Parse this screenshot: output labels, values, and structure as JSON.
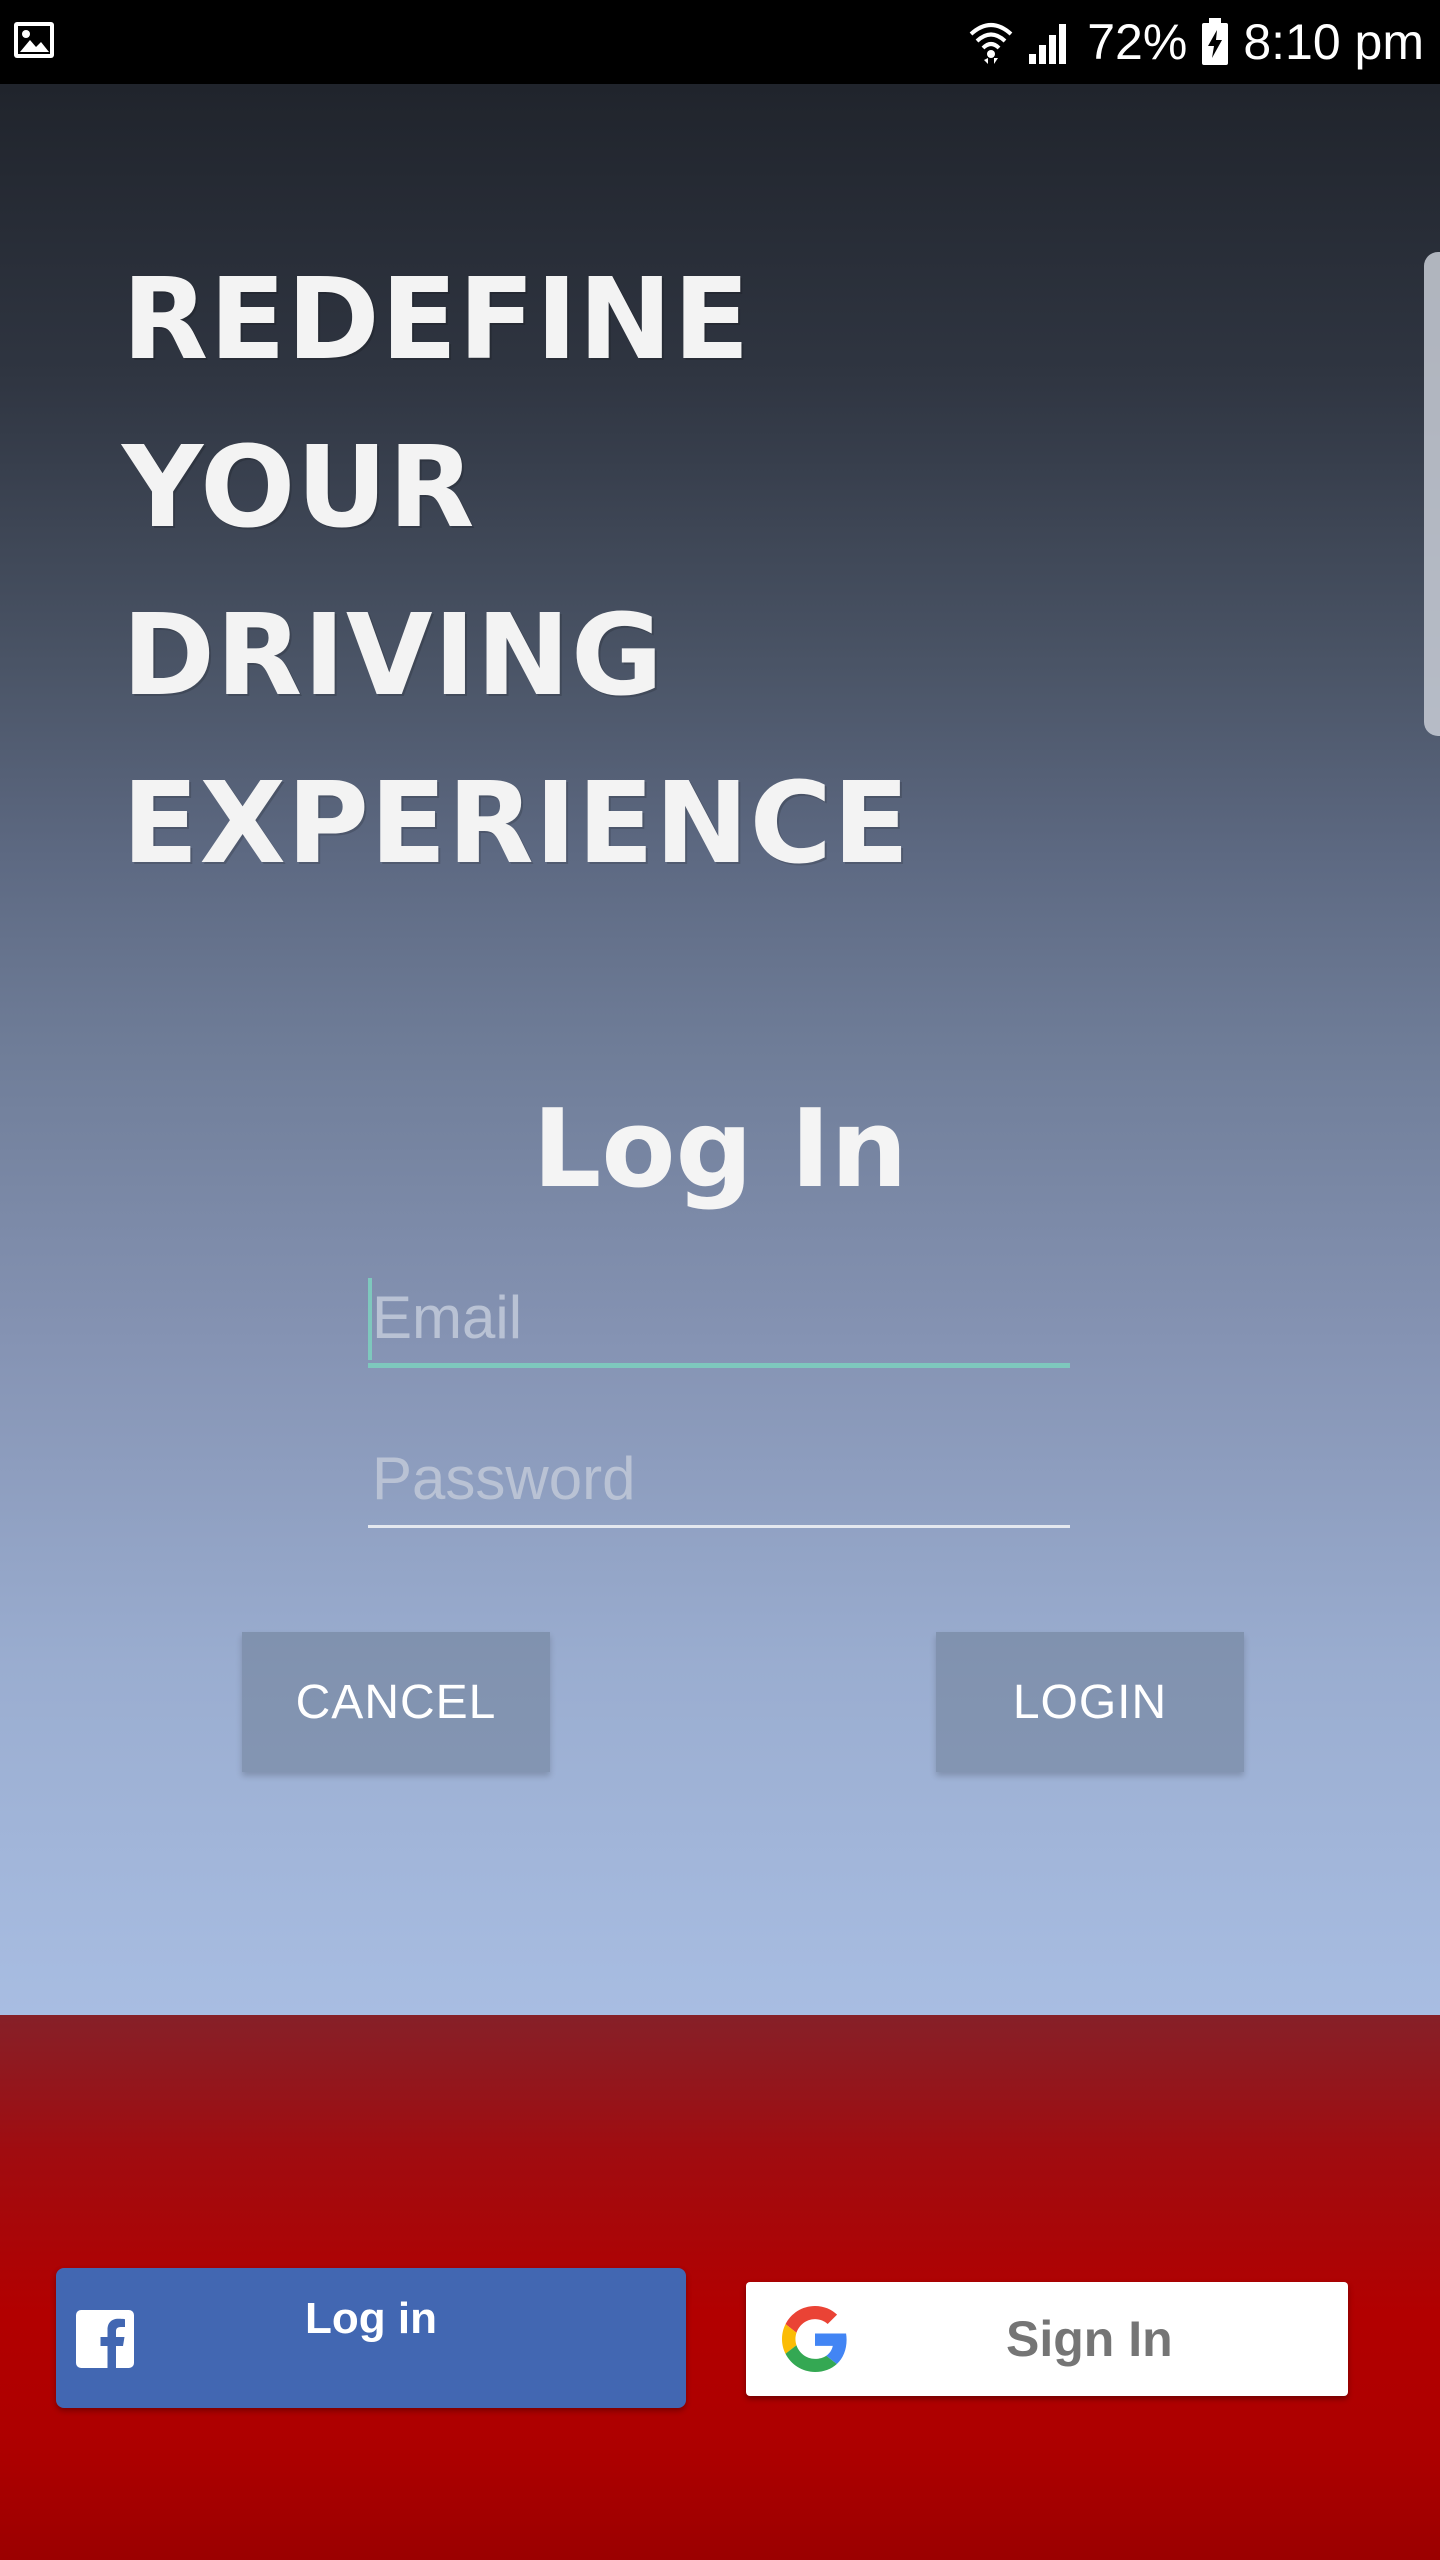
{
  "status_bar": {
    "battery": "72%",
    "time": "8:10 pm"
  },
  "hero": {
    "tagline": [
      "REDEFINE",
      "YOUR",
      "DRIVING",
      "EXPERIENCE"
    ],
    "login_title": "Log In"
  },
  "form": {
    "email_placeholder": "Email",
    "email_value": "",
    "password_placeholder": "Password",
    "password_value": "",
    "cancel_label": "CANCEL",
    "login_label": "LOGIN"
  },
  "social": {
    "facebook_label": "Log in",
    "google_label": "Sign In"
  },
  "colors": {
    "facebook_blue": "#4267b2",
    "accent_teal": "#7ec8bd",
    "social_red": "#b20000"
  },
  "icons": {
    "status_left": "image-icon",
    "wifi": "wifi-icon",
    "signal": "signal-icon",
    "battery": "battery-charging-icon",
    "facebook": "facebook-icon",
    "google": "google-icon"
  }
}
